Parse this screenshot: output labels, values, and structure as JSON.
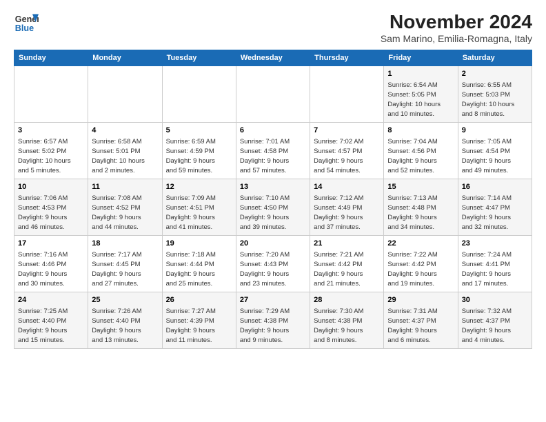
{
  "header": {
    "logo_line1": "General",
    "logo_line2": "Blue",
    "month_title": "November 2024",
    "location": "Sam Marino, Emilia-Romagna, Italy"
  },
  "weekdays": [
    "Sunday",
    "Monday",
    "Tuesday",
    "Wednesday",
    "Thursday",
    "Friday",
    "Saturday"
  ],
  "weeks": [
    [
      {
        "day": "",
        "info": ""
      },
      {
        "day": "",
        "info": ""
      },
      {
        "day": "",
        "info": ""
      },
      {
        "day": "",
        "info": ""
      },
      {
        "day": "",
        "info": ""
      },
      {
        "day": "1",
        "info": "Sunrise: 6:54 AM\nSunset: 5:05 PM\nDaylight: 10 hours\nand 10 minutes."
      },
      {
        "day": "2",
        "info": "Sunrise: 6:55 AM\nSunset: 5:03 PM\nDaylight: 10 hours\nand 8 minutes."
      }
    ],
    [
      {
        "day": "3",
        "info": "Sunrise: 6:57 AM\nSunset: 5:02 PM\nDaylight: 10 hours\nand 5 minutes."
      },
      {
        "day": "4",
        "info": "Sunrise: 6:58 AM\nSunset: 5:01 PM\nDaylight: 10 hours\nand 2 minutes."
      },
      {
        "day": "5",
        "info": "Sunrise: 6:59 AM\nSunset: 4:59 PM\nDaylight: 9 hours\nand 59 minutes."
      },
      {
        "day": "6",
        "info": "Sunrise: 7:01 AM\nSunset: 4:58 PM\nDaylight: 9 hours\nand 57 minutes."
      },
      {
        "day": "7",
        "info": "Sunrise: 7:02 AM\nSunset: 4:57 PM\nDaylight: 9 hours\nand 54 minutes."
      },
      {
        "day": "8",
        "info": "Sunrise: 7:04 AM\nSunset: 4:56 PM\nDaylight: 9 hours\nand 52 minutes."
      },
      {
        "day": "9",
        "info": "Sunrise: 7:05 AM\nSunset: 4:54 PM\nDaylight: 9 hours\nand 49 minutes."
      }
    ],
    [
      {
        "day": "10",
        "info": "Sunrise: 7:06 AM\nSunset: 4:53 PM\nDaylight: 9 hours\nand 46 minutes."
      },
      {
        "day": "11",
        "info": "Sunrise: 7:08 AM\nSunset: 4:52 PM\nDaylight: 9 hours\nand 44 minutes."
      },
      {
        "day": "12",
        "info": "Sunrise: 7:09 AM\nSunset: 4:51 PM\nDaylight: 9 hours\nand 41 minutes."
      },
      {
        "day": "13",
        "info": "Sunrise: 7:10 AM\nSunset: 4:50 PM\nDaylight: 9 hours\nand 39 minutes."
      },
      {
        "day": "14",
        "info": "Sunrise: 7:12 AM\nSunset: 4:49 PM\nDaylight: 9 hours\nand 37 minutes."
      },
      {
        "day": "15",
        "info": "Sunrise: 7:13 AM\nSunset: 4:48 PM\nDaylight: 9 hours\nand 34 minutes."
      },
      {
        "day": "16",
        "info": "Sunrise: 7:14 AM\nSunset: 4:47 PM\nDaylight: 9 hours\nand 32 minutes."
      }
    ],
    [
      {
        "day": "17",
        "info": "Sunrise: 7:16 AM\nSunset: 4:46 PM\nDaylight: 9 hours\nand 30 minutes."
      },
      {
        "day": "18",
        "info": "Sunrise: 7:17 AM\nSunset: 4:45 PM\nDaylight: 9 hours\nand 27 minutes."
      },
      {
        "day": "19",
        "info": "Sunrise: 7:18 AM\nSunset: 4:44 PM\nDaylight: 9 hours\nand 25 minutes."
      },
      {
        "day": "20",
        "info": "Sunrise: 7:20 AM\nSunset: 4:43 PM\nDaylight: 9 hours\nand 23 minutes."
      },
      {
        "day": "21",
        "info": "Sunrise: 7:21 AM\nSunset: 4:42 PM\nDaylight: 9 hours\nand 21 minutes."
      },
      {
        "day": "22",
        "info": "Sunrise: 7:22 AM\nSunset: 4:42 PM\nDaylight: 9 hours\nand 19 minutes."
      },
      {
        "day": "23",
        "info": "Sunrise: 7:24 AM\nSunset: 4:41 PM\nDaylight: 9 hours\nand 17 minutes."
      }
    ],
    [
      {
        "day": "24",
        "info": "Sunrise: 7:25 AM\nSunset: 4:40 PM\nDaylight: 9 hours\nand 15 minutes."
      },
      {
        "day": "25",
        "info": "Sunrise: 7:26 AM\nSunset: 4:40 PM\nDaylight: 9 hours\nand 13 minutes."
      },
      {
        "day": "26",
        "info": "Sunrise: 7:27 AM\nSunset: 4:39 PM\nDaylight: 9 hours\nand 11 minutes."
      },
      {
        "day": "27",
        "info": "Sunrise: 7:29 AM\nSunset: 4:38 PM\nDaylight: 9 hours\nand 9 minutes."
      },
      {
        "day": "28",
        "info": "Sunrise: 7:30 AM\nSunset: 4:38 PM\nDaylight: 9 hours\nand 8 minutes."
      },
      {
        "day": "29",
        "info": "Sunrise: 7:31 AM\nSunset: 4:37 PM\nDaylight: 9 hours\nand 6 minutes."
      },
      {
        "day": "30",
        "info": "Sunrise: 7:32 AM\nSunset: 4:37 PM\nDaylight: 9 hours\nand 4 minutes."
      }
    ]
  ]
}
